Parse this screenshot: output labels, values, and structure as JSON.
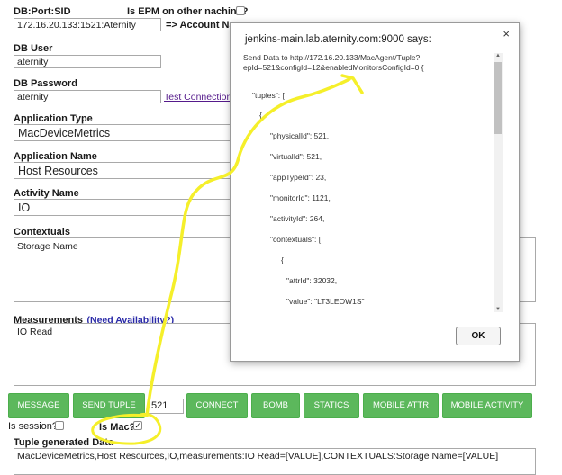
{
  "form": {
    "db_port_sid": {
      "label": "DB:Port:SID",
      "value": "172.16.20.133:1521:Aternity"
    },
    "epm": {
      "label": "Is EPM on other nachine?"
    },
    "account_label": "=> Account Na",
    "db_user": {
      "label": "DB User",
      "value": "aternity"
    },
    "db_password": {
      "label": "DB Password",
      "value": "aternity"
    },
    "test_connection": "Test Connection",
    "application_type": {
      "label": "Application Type",
      "value": "MacDeviceMetrics"
    },
    "application_name": {
      "label": "Application Name",
      "value": "Host Resources"
    },
    "activity_name": {
      "label": "Activity Name",
      "value": "IO"
    },
    "contextuals": {
      "label": "Contextuals",
      "value": "Storage Name"
    },
    "measurements": {
      "label": "Measurements",
      "link": "(Need Availability?)",
      "value": "IO Read"
    },
    "buttons": {
      "message": "MESSAGE",
      "send_tuple": "SEND TUPLE",
      "tuple_count": "521",
      "connect": "CONNECT",
      "bomb": "BOMB",
      "statics": "STATICS",
      "mobile_attr": "MOBILE ATTR",
      "mobile_activity": "MOBILE ACTIVITY"
    },
    "is_session": {
      "label": "Is session?",
      "checked": false
    },
    "is_mac": {
      "label": "Is Mac?",
      "checked": true
    },
    "tuple_generated": {
      "label": "Tuple generated Data",
      "value": "MacDeviceMetrics,Host Resources,IO,measurements:IO Read=[VALUE],CONTEXTUALS:Storage Name=[VALUE]"
    }
  },
  "dialog": {
    "title": "jenkins-main.lab.aternity.com:9000 says:",
    "close": "×",
    "message_line1": "Send Data to http://172.16.20.133/MacAgent/Tuple?",
    "message_line2": "epId=521&configId=12&enabledMonitorsConfigId=0  {",
    "json_lines": [
      "\"tuples\": [",
      "{",
      "\"physicalId\": 521,",
      "\"virtualId\": 521,",
      "\"appTypeId\": 23,",
      "\"monitorId\": 1121,",
      "\"activityId\": 264,",
      "\"contextuals\": [",
      "{",
      "\"attrId\": 32032,",
      "\"value\": \"LT3LEOW1S\""
    ],
    "ok": "OK"
  },
  "colors": {
    "button_green": "#5cb85c",
    "annotation_yellow": "#f5ef2a",
    "link": "#551a8b"
  }
}
